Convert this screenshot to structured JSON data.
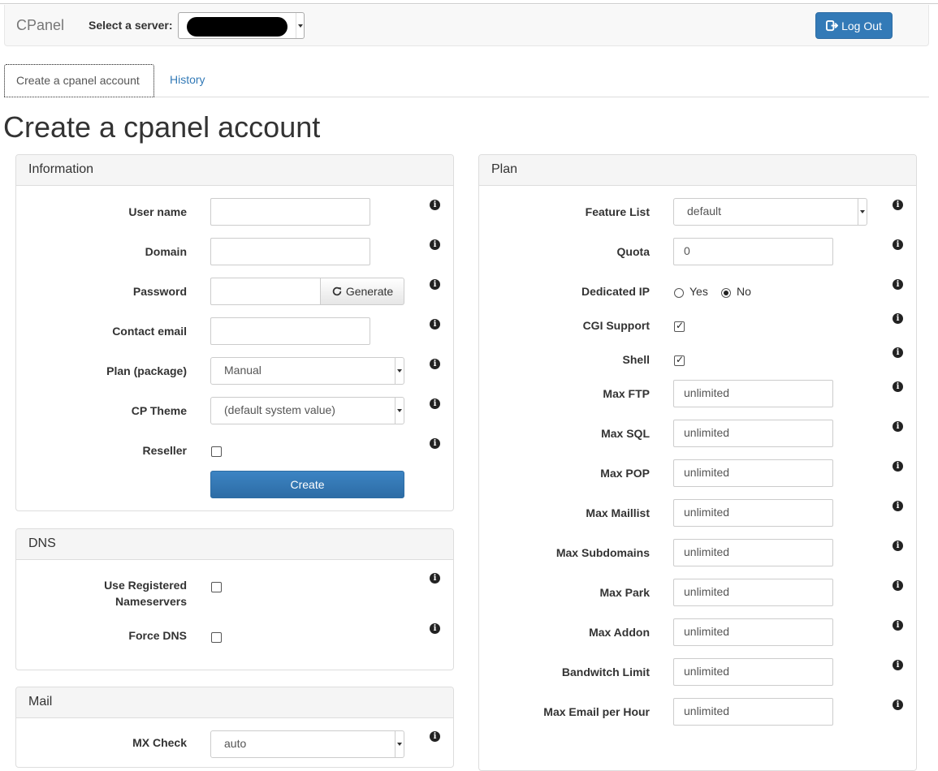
{
  "navbar": {
    "brand": "CPanel",
    "server_label": "Select a server:",
    "logout_label": "Log Out"
  },
  "tabs": [
    {
      "label": "Create a cpanel account"
    },
    {
      "label": "History"
    }
  ],
  "page_title": "Create a cpanel account",
  "info_panel": {
    "heading": "Information",
    "username_label": "User name",
    "domain_label": "Domain",
    "password_label": "Password",
    "generate_label": "Generate",
    "contact_email_label": "Contact email",
    "plan_label": "Plan (package)",
    "plan_value": "Manual",
    "cp_theme_label": "CP Theme",
    "cp_theme_value": "(default system value)",
    "reseller_label": "Reseller",
    "create_label": "Create"
  },
  "dns_panel": {
    "heading": "DNS",
    "use_registered_label_1": "Use Registered",
    "use_registered_label_2": "Nameservers",
    "force_dns_label": "Force DNS"
  },
  "mail_panel": {
    "heading": "Mail",
    "mx_check_label": "MX Check",
    "mx_check_value": "auto"
  },
  "plan_panel": {
    "heading": "Plan",
    "feature_list_label": "Feature List",
    "feature_list_value": "default",
    "quota_label": "Quota",
    "quota_value": "0",
    "dedicated_ip_label": "Dedicated IP",
    "dedicated_ip_yes": "Yes",
    "dedicated_ip_no": "No",
    "cgi_label": "CGI Support",
    "shell_label": "Shell",
    "limits": [
      {
        "label": "Max FTP",
        "value": "unlimited"
      },
      {
        "label": "Max SQL",
        "value": "unlimited"
      },
      {
        "label": "Max POP",
        "value": "unlimited"
      },
      {
        "label": "Max Maillist",
        "value": "unlimited"
      },
      {
        "label": "Max Subdomains",
        "value": "unlimited"
      },
      {
        "label": "Max Park",
        "value": "unlimited"
      },
      {
        "label": "Max Addon",
        "value": "unlimited"
      },
      {
        "label": "Bandwitch Limit",
        "value": "unlimited"
      },
      {
        "label": "Max Email per Hour",
        "value": "unlimited"
      }
    ]
  },
  "colors": {
    "primary": "#337ab7",
    "link": "#337ab7",
    "panel_heading_bg": "#f5f5f5"
  }
}
